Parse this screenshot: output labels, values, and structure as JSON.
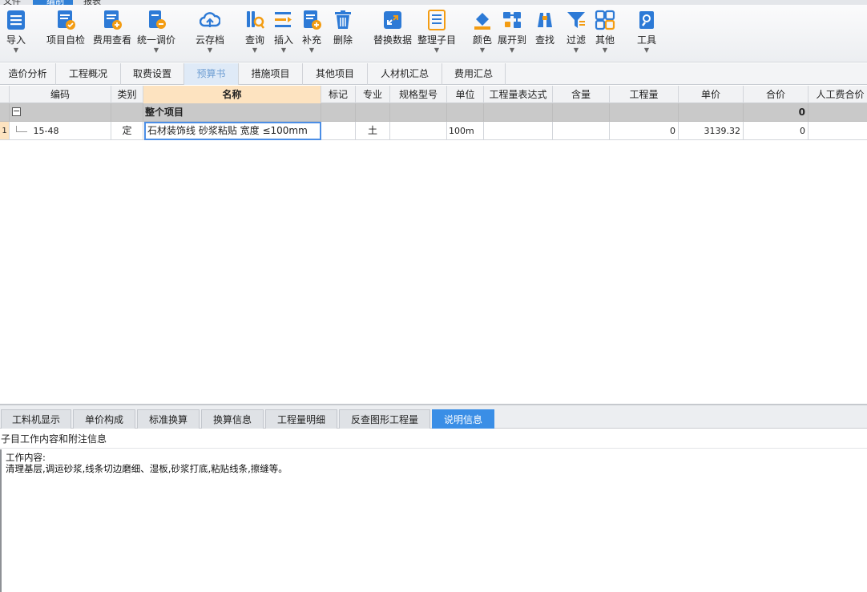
{
  "menubar": {
    "items": [
      "文件",
      "编制",
      "报表"
    ]
  },
  "toolbar": {
    "buttons": [
      {
        "label": "导入",
        "icon": "import-icon",
        "dropdown": true
      },
      {
        "label": "项目自检",
        "icon": "project-check-icon",
        "dropdown": false
      },
      {
        "label": "费用查看",
        "icon": "cost-view-icon",
        "dropdown": false
      },
      {
        "label": "统一调价",
        "icon": "unified-price-adjust-icon",
        "dropdown": true
      },
      {
        "label": "云存档",
        "icon": "cloud-archive-icon",
        "dropdown": true
      },
      {
        "label": "查询",
        "icon": "query-icon",
        "dropdown": true
      },
      {
        "label": "插入",
        "icon": "insert-icon",
        "dropdown": true
      },
      {
        "label": "补充",
        "icon": "supplement-icon",
        "dropdown": true
      },
      {
        "label": "删除",
        "icon": "delete-icon",
        "dropdown": false
      },
      {
        "label": "替换数据",
        "icon": "replace-data-icon",
        "dropdown": false
      },
      {
        "label": "整理子目",
        "icon": "organize-items-icon",
        "dropdown": true
      },
      {
        "label": "颜色",
        "icon": "color-icon",
        "dropdown": true
      },
      {
        "label": "展开到",
        "icon": "expand-to-icon",
        "dropdown": true
      },
      {
        "label": "查找",
        "icon": "find-icon",
        "dropdown": false
      },
      {
        "label": "过滤",
        "icon": "filter-icon",
        "dropdown": true
      },
      {
        "label": "其他",
        "icon": "other-icon",
        "dropdown": true
      },
      {
        "label": "工具",
        "icon": "tools-icon",
        "dropdown": true
      }
    ]
  },
  "view_tabs": [
    "造价分析",
    "工程概况",
    "取费设置",
    "预算书",
    "措施项目",
    "其他项目",
    "人材机汇总",
    "费用汇总"
  ],
  "active_view_tab": "预算书",
  "grid": {
    "columns": [
      "编码",
      "类别",
      "名称",
      "标记",
      "专业",
      "规格型号",
      "单位",
      "工程量表达式",
      "含量",
      "工程量",
      "单价",
      "合价",
      "人工费合价"
    ],
    "group_row": {
      "toggle": "−",
      "name": "整个项目",
      "total": "0"
    },
    "rows": [
      {
        "index": "1",
        "code": "15-48",
        "category": "定",
        "name": "石材装饰线 砂浆粘贴 宽度 ≤100mm",
        "major": "土",
        "unit": "100m",
        "quantity": "0",
        "unit_price": "3139.32",
        "total_price": "0"
      }
    ]
  },
  "bottom_tabs": [
    "工料机显示",
    "单价构成",
    "标准换算",
    "换算信息",
    "工程量明细",
    "反查图形工程量",
    "说明信息"
  ],
  "active_bottom_tab": "说明信息",
  "info_panel": {
    "title": "子目工作内容和附注信息",
    "line1": "工作内容:",
    "line2": "清理基层,调运砂浆,线条切边磨细、湿板,砂浆打底,粘贴线条,擦缝等。"
  },
  "colors": {
    "accent": "#3a8ee6",
    "selected_header": "#fde3c0",
    "group_row": "#c9c9c9",
    "active_view_tab_text": "#6f9fd3"
  }
}
